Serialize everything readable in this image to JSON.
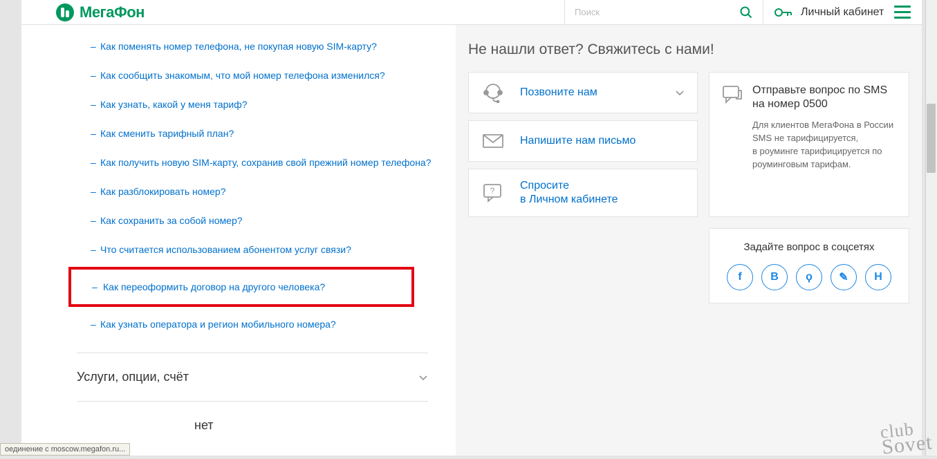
{
  "header": {
    "logo_text": "МегаФон",
    "search_placeholder": "Поиск",
    "cabinet_label": "Личный кабинет"
  },
  "faq": {
    "items": [
      {
        "text": "Как поменять номер телефона, не покупая новую SIM-карту?",
        "hl": false
      },
      {
        "text": "Как сообщить знакомым, что мой номер телефона изменился?",
        "hl": false
      },
      {
        "text": "Как узнать, какой у меня тариф?",
        "hl": false
      },
      {
        "text": "Как сменить тарифный план?",
        "hl": false
      },
      {
        "text": "Как получить новую SIM-карту, сохранив свой прежний номер телефона?",
        "hl": false
      },
      {
        "text": "Как разблокировать номер?",
        "hl": false
      },
      {
        "text": "Как сохранить за собой номер?",
        "hl": false
      },
      {
        "text": "Что считается использованием абонентом услуг связи?",
        "hl": false
      },
      {
        "text": "Как переоформить договор на другого человека?",
        "hl": true
      },
      {
        "text": "Как узнать оператора и регион мобильного номера?",
        "hl": false
      }
    ],
    "accordion1": "Услуги, опции, счёт",
    "accordion2": "нет"
  },
  "right": {
    "title": "Не нашли ответ? Свяжитесь с нами!",
    "call": "Позвоните нам",
    "write": "Напишите нам письмо",
    "ask_line1": "Спросите",
    "ask_line2": "в Личном кабинете",
    "sms_title": "Отправьте вопрос по SMS на номер 0500",
    "sms_body": "Для клиентов МегаФона в России SMS не тарифицируется,\nв роуминге тарифицируется по роуминговым тарифам.",
    "soc_title": "Задайте вопрос в соцсетях",
    "soc": {
      "fb": "f",
      "vk": "В",
      "ok": "ϙ",
      "lj": "✎",
      "hb": "Н"
    }
  },
  "status": "оединение с moscow.megafon.ru...",
  "watermark_top": "club",
  "watermark_bot": "Sovet"
}
